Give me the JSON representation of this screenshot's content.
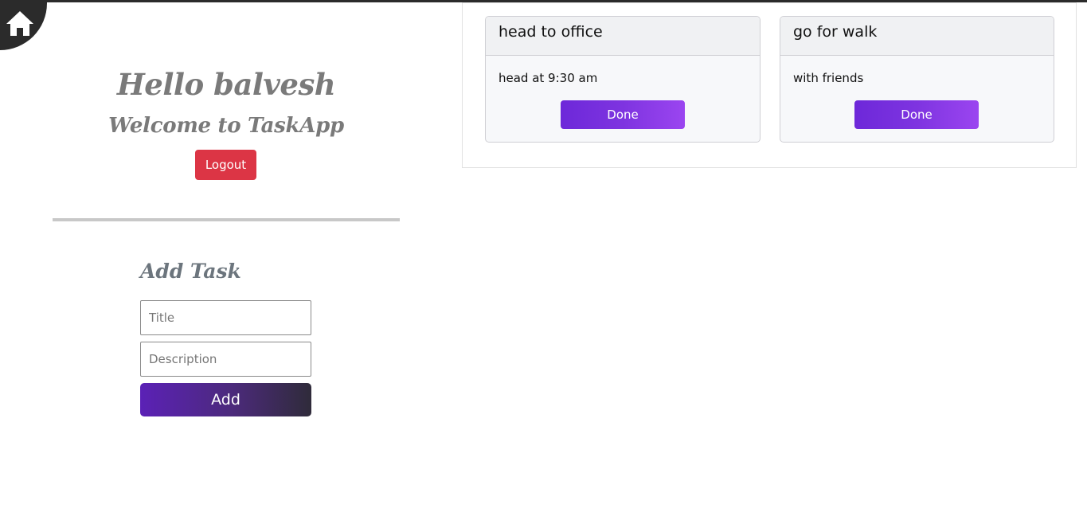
{
  "header": {
    "greeting": "Hello balvesh",
    "welcome": "Welcome to TaskApp",
    "logout_label": "Logout"
  },
  "add_task": {
    "heading": "Add Task",
    "title_placeholder": "Title",
    "description_placeholder": "Description",
    "add_label": "Add"
  },
  "tasks": [
    {
      "title": "head to office",
      "description": "head at 9:30 am",
      "done_label": "Done"
    },
    {
      "title": "go for walk",
      "description": "with friends",
      "done_label": "Done"
    }
  ],
  "colors": {
    "logout": "#dc3545",
    "done_gradient_start": "#6d28d9",
    "done_gradient_end": "#9b45f0",
    "add_gradient_start": "#5b21b6",
    "add_gradient_end": "#2f2b3a",
    "heading_gray": "#7a7a7a"
  },
  "icons": {
    "home": "home-icon"
  }
}
